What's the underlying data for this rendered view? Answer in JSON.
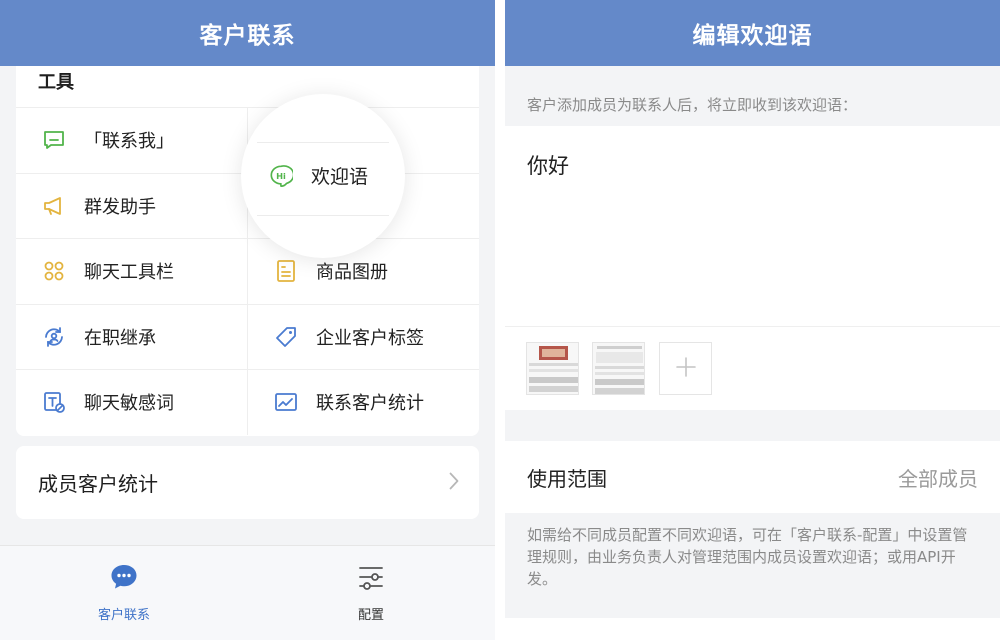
{
  "left": {
    "nav_title": "客户联系",
    "tools_title": "工具",
    "tools": [
      {
        "label": "「联系我」",
        "icon": "chat-bubble-icon"
      },
      {
        "label": "",
        "icon": ""
      },
      {
        "label": "群发助手",
        "icon": "megaphone-icon"
      },
      {
        "label": "",
        "icon": ""
      },
      {
        "label": "聊天工具栏",
        "icon": "tools-icon"
      },
      {
        "label": "商品图册",
        "icon": "catalog-icon"
      },
      {
        "label": "在职继承",
        "icon": "transfer-icon"
      },
      {
        "label": "企业客户标签",
        "icon": "tag-icon"
      },
      {
        "label": "聊天敏感词",
        "icon": "sensitive-words-icon"
      },
      {
        "label": "联系客户统计",
        "icon": "chart-icon"
      }
    ],
    "highlight": {
      "label": "欢迎语",
      "icon": "hi-bubble-icon"
    },
    "member_stats": "成员客户统计",
    "tabs": [
      {
        "label": "客户联系",
        "icon": "chat-icon",
        "active": true
      },
      {
        "label": "配置",
        "icon": "settings-sliders-icon",
        "active": false
      }
    ]
  },
  "right": {
    "nav_title": "编辑欢迎语",
    "hint": "客户添加成员为联系人后，将立即收到该欢迎语：",
    "message": "你好",
    "add_icon": "plus-icon",
    "scope_label": "使用范围",
    "scope_value": "全部成员",
    "note": "如需给不同成员配置不同欢迎语，可在「客户联系-配置」中设置管理规则，由业务负责人对管理范围内成员设置欢迎语；或用API开发。"
  },
  "colors": {
    "brand": "#6489c9",
    "active": "#3f73c8",
    "green": "#52b44b",
    "yellow": "#e3b43f"
  }
}
